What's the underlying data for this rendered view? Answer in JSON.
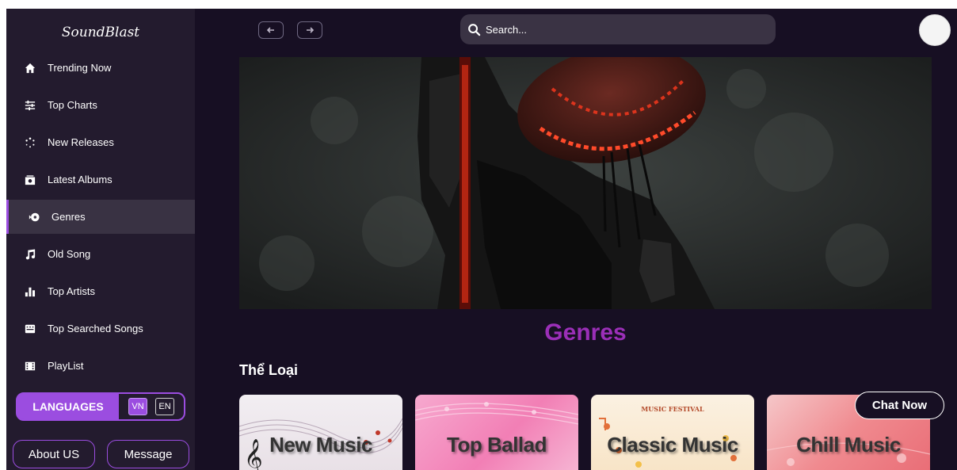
{
  "app": {
    "logo": "SoundBlast"
  },
  "sidebar": {
    "items": [
      {
        "label": "Trending Now",
        "icon": "home-icon"
      },
      {
        "label": "Top Charts",
        "icon": "sliders-icon"
      },
      {
        "label": "New Releases",
        "icon": "spinner-icon"
      },
      {
        "label": "Latest Albums",
        "icon": "album-icon"
      },
      {
        "label": "Genres",
        "icon": "genres-icon",
        "active": true
      },
      {
        "label": "Old Song",
        "icon": "music-note-icon"
      },
      {
        "label": "Top Artists",
        "icon": "bar-chart-icon"
      },
      {
        "label": "Top Searched Songs",
        "icon": "keyboard-icon"
      },
      {
        "label": "PlayList",
        "icon": "film-icon"
      }
    ],
    "languages": {
      "label": "LANGUAGES",
      "options": [
        "VN",
        "EN"
      ],
      "selected": "VN"
    },
    "about_label": "About US",
    "message_label": "Message"
  },
  "header": {
    "search_placeholder": "Search..."
  },
  "main": {
    "title": "Genres",
    "section_title": "Thể Loại",
    "cards": [
      {
        "label": "New Music"
      },
      {
        "label": "Top Ballad"
      },
      {
        "label": "Classic Music",
        "tag": "MUSIC FESTIVAL"
      },
      {
        "label": "Chill Music"
      }
    ]
  },
  "chat": {
    "label": "Chat Now"
  },
  "colors": {
    "accent": "#9b4de0",
    "background": "#170f23",
    "sidebar": "#231b2e",
    "title": "#9b2fb8"
  }
}
